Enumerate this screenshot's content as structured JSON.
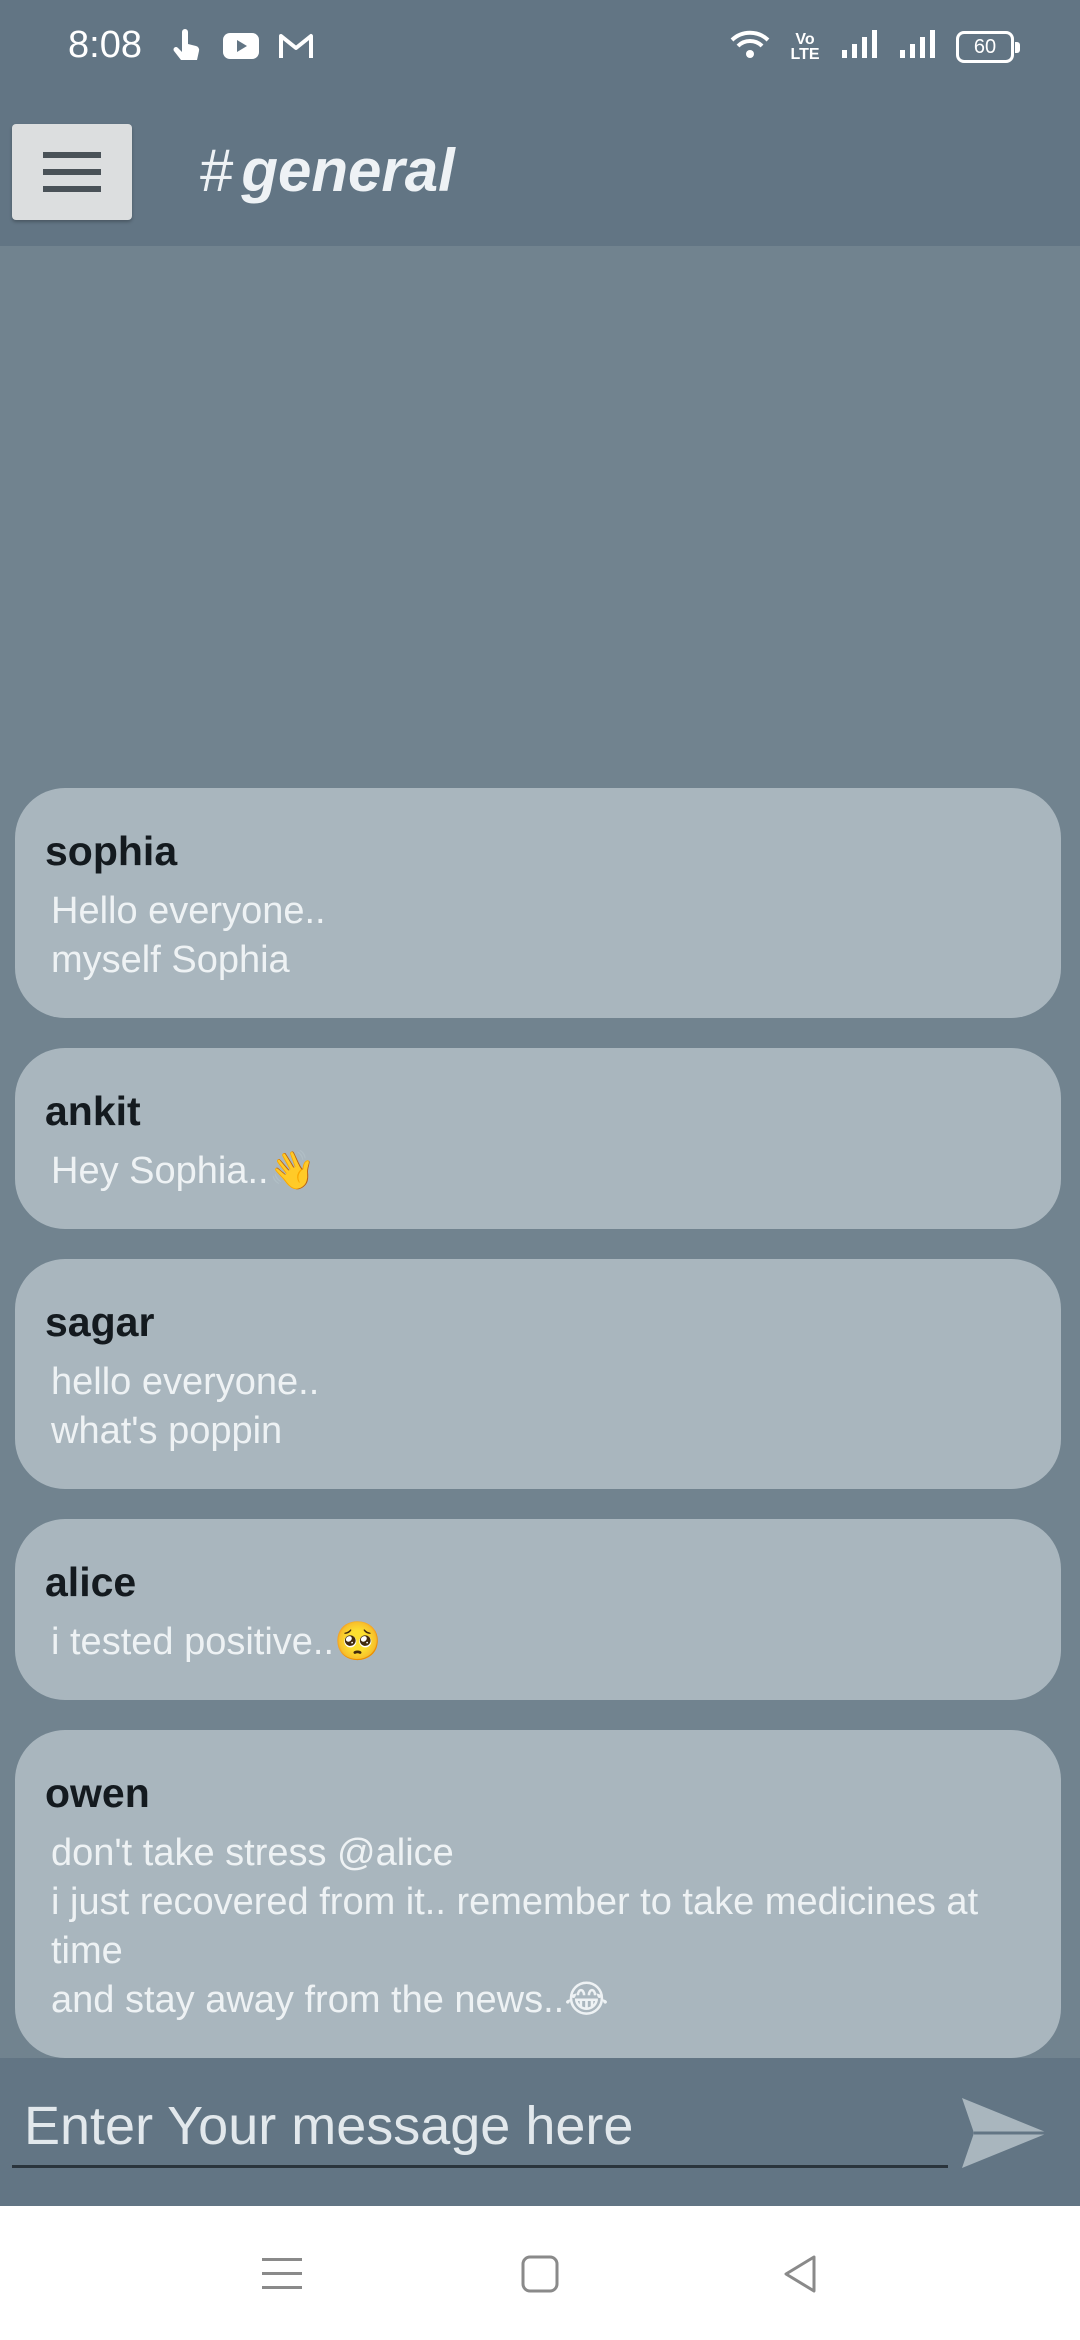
{
  "status_bar": {
    "time": "8:08",
    "battery": "60",
    "network_label": "Vo LTE",
    "icons": [
      "touch-icon",
      "youtube-icon",
      "gmail-icon",
      "wifi-icon",
      "volte-icon",
      "signal-icon",
      "signal-icon",
      "battery-icon"
    ]
  },
  "header": {
    "hash": "#",
    "channel": "general",
    "menu_icon": "hamburger-menu-icon"
  },
  "messages": [
    {
      "user": "sophia",
      "text": "Hello everyone..\nmyself Sophia"
    },
    {
      "user": "ankit",
      "text": "Hey Sophia..👋"
    },
    {
      "user": "sagar",
      "text": "hello everyone..\nwhat's poppin"
    },
    {
      "user": "alice",
      "text": "i tested positive..🥺"
    },
    {
      "user": "owen",
      "text": "don't take stress @alice\ni just recovered from it.. remember to take medicines at time\nand stay away from the news..😂"
    }
  ],
  "composer": {
    "placeholder": "Enter Your message here",
    "send_icon": "send-icon"
  },
  "nav": {
    "icons": [
      "recents-icon",
      "home-icon",
      "back-icon"
    ]
  },
  "colors": {
    "header_bg": "#627584",
    "chat_bg": "#71838f",
    "bubble_bg": "#a9b6be",
    "nav_bg": "#ffffff"
  }
}
